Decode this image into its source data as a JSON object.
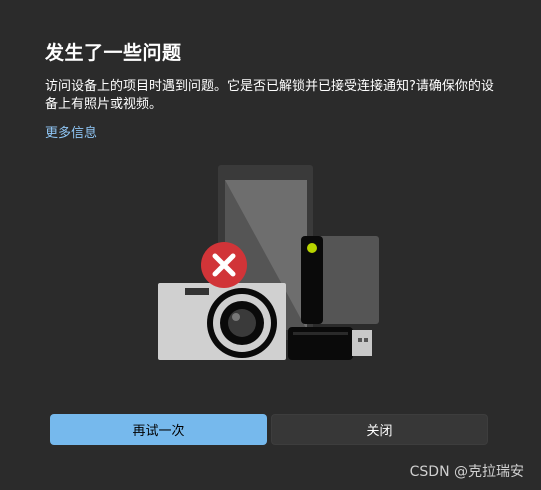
{
  "dialog": {
    "title": "发生了一些问题",
    "message": "访问设备上的项目时遇到问题。它是否已解锁并已接受连接通知?请确保你的设备上有照片或视频。",
    "more_info_link": "更多信息",
    "retry_button": "再试一次",
    "close_button": "关闭"
  },
  "illustration": {
    "icons": [
      "phone-icon",
      "external-drive-icon",
      "camera-icon",
      "usb-drive-icon",
      "error-x-icon"
    ]
  },
  "watermark": "CSDN @克拉瑞安",
  "colors": {
    "background": "#2b2b2b",
    "accent": "#76b9ed",
    "link": "#8fc6f5",
    "error": "#d13438"
  }
}
